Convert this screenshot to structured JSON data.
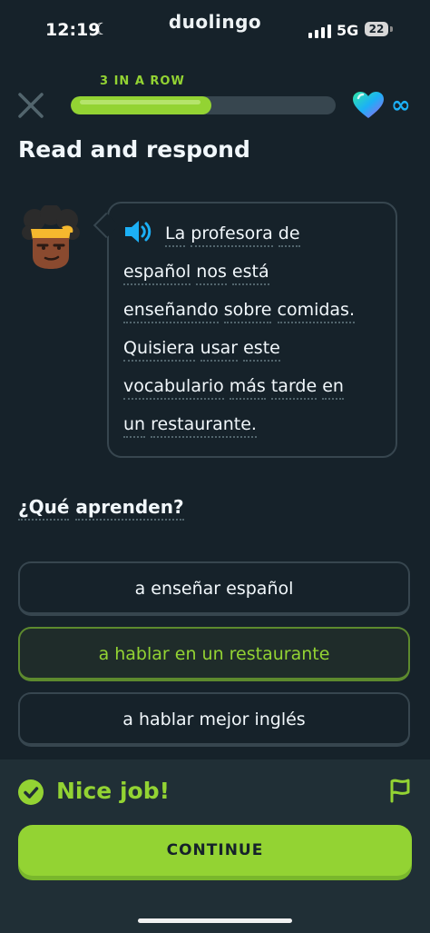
{
  "status_bar": {
    "time": "12:19",
    "network": "5G",
    "battery": "22",
    "app_name": "duolingo"
  },
  "header": {
    "streak_label": "3 IN A ROW",
    "progress": 0.53,
    "hearts": "∞"
  },
  "page_title": "Read and respond",
  "passage": {
    "lines": [
      [
        "La",
        "profesora",
        "de"
      ],
      [
        "español",
        "nos",
        "está"
      ],
      [
        "enseñando",
        "sobre",
        "comidas."
      ],
      [
        "Quisiera",
        "usar",
        "este"
      ],
      [
        "vocabulario",
        "más",
        "tarde",
        "en"
      ],
      [
        "un",
        "restaurante."
      ]
    ]
  },
  "question": [
    "¿Qué",
    "aprenden?"
  ],
  "options": [
    {
      "label": "a enseñar español",
      "selected": false
    },
    {
      "label": "a hablar en un restaurante",
      "selected": true
    },
    {
      "label": "a hablar mejor inglés",
      "selected": false
    }
  ],
  "feedback": {
    "message": "Nice job!",
    "continue_label": "CONTINUE"
  },
  "colors": {
    "background": "#16222a",
    "accent_green": "#93d333",
    "heart_blue": "#1cb0f6",
    "border": "#37464f"
  },
  "icons": [
    "moon-icon",
    "signal-icon",
    "battery-icon",
    "close-icon",
    "heart-icon",
    "infinity-icon",
    "speaker-icon",
    "check-icon",
    "flag-icon"
  ]
}
